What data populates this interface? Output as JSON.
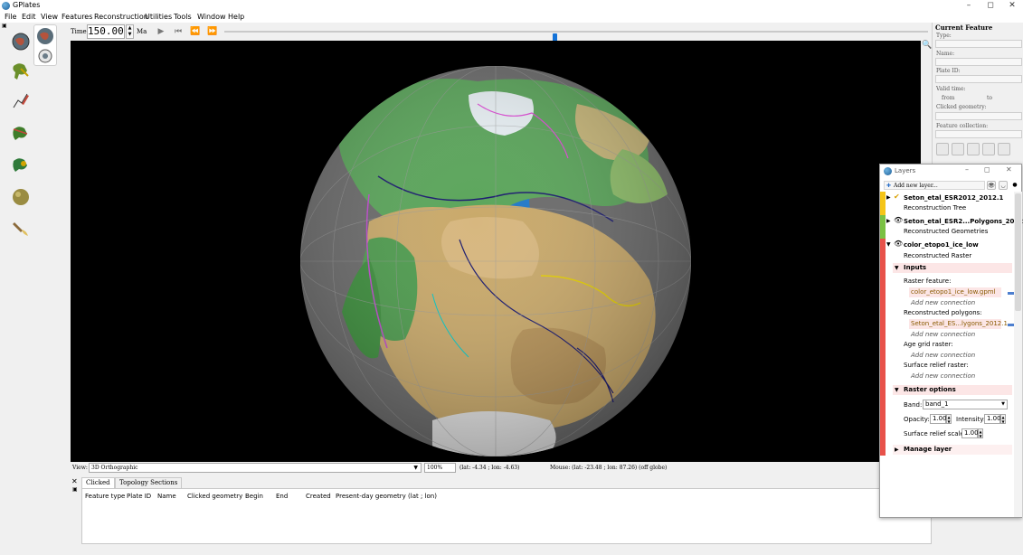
{
  "window": {
    "title": "GPlates",
    "controls": [
      "–",
      "◻",
      "✕"
    ]
  },
  "menu": [
    "File",
    "Edit",
    "View",
    "Features",
    "Reconstruction",
    "Utilities",
    "Tools",
    "Window",
    "Help"
  ],
  "tools": [
    "globe-rotate-icon",
    "globe-zoom-icon",
    "measure-icon",
    "feature-select-icon",
    "digitize-icon",
    "topology-icon",
    "reconstruction-pole-icon",
    "small-circle-icon",
    "hand-tool-icon"
  ],
  "timebar": {
    "time_label": "Time:",
    "time_value": "150.00",
    "unit": "Ma",
    "spin_up": "▲",
    "spin_down": "▼",
    "play": "▶",
    "to_start": "⏮",
    "step_back": "⏪",
    "step_forward": "⏩",
    "slider_position": 0.47
  },
  "status": {
    "view_label": "View:",
    "view_value": "3D Orthographic",
    "zoom_value": "100%",
    "camera_coords": "(lat: -4.34 ; lon: -4.63)",
    "mouse_coords": "Mouse: (lat: -23.48 ; lon: 87.26) (off globe)"
  },
  "bottom": {
    "tabs": [
      "Clicked",
      "Topology Sections"
    ],
    "columns": [
      "Feature type",
      "Plate ID",
      "Name",
      "Clicked geometry",
      "Begin",
      "End",
      "Created",
      "Present-day geometry (lat ; lon)"
    ]
  },
  "current_feature": {
    "title": "Current Feature",
    "fields": [
      "Type:",
      "Name:",
      "Plate ID:",
      "Valid time:",
      "from",
      "to",
      "Clicked geometry:",
      "Feature collection:"
    ]
  },
  "layers": {
    "title": "Layers",
    "add_button": "Add new layer...",
    "items": [
      {
        "name": "Seton_etal_ESR2012_2012.1",
        "type": "Reconstruction Tree",
        "color": "#f5c518",
        "checked": true
      },
      {
        "name": "Seton_etal_ESR2...Polygons_2012.1",
        "type": "Reconstructed Geometries",
        "color": "#7ac143",
        "checked": true
      },
      {
        "name": "color_etopo1_ice_low",
        "type": "Reconstructed Raster",
        "color": "#e8524a",
        "checked": true
      }
    ],
    "inputs": {
      "header": "Inputs",
      "raster_feature_label": "Raster feature:",
      "raster_feature_value": "color_etopo1_ice_low.gpml",
      "add_new_connection": "Add new connection",
      "reconstructed_polygons_label": "Reconstructed polygons:",
      "reconstructed_polygons_value": "Seton_etal_ES...lygons_2012.1",
      "age_grid_label": "Age grid raster:",
      "surface_relief_label": "Surface relief raster:"
    },
    "raster_options": {
      "header": "Raster options",
      "band_label": "Band:",
      "band_value": "band_1",
      "opacity_label": "Opacity:",
      "opacity_value": "1.00",
      "intensity_label": "Intensity:",
      "intensity_value": "1.00",
      "relief_label": "Surface relief scale:",
      "relief_value": "1.00"
    },
    "manage_layer": "Manage layer"
  }
}
